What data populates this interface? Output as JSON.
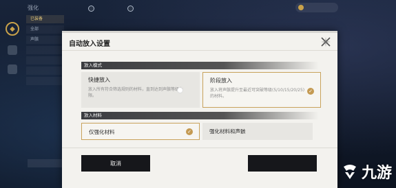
{
  "background": {
    "top_title": "强化",
    "top_right_value": "",
    "left_list": [
      "已装备",
      "全部",
      "声骸",
      "",
      "",
      "",
      ""
    ]
  },
  "modal": {
    "title": "自动放入设置",
    "mode_section": {
      "header": "放入模式",
      "options": [
        {
          "title": "快捷放入",
          "desc": "放入所有符合筛选规则的材料，直到达到声骸等级上限。",
          "selected": false
        },
        {
          "title": "阶段放入",
          "desc": "放入将声骸提升至最近可突破等级(5/10/15/20/25)的材料。",
          "selected": true
        }
      ]
    },
    "material_section": {
      "header": "放入材料",
      "options": [
        {
          "label": "仅强化材料",
          "selected": true
        },
        {
          "label": "强化材料和声骸",
          "selected": false
        }
      ]
    },
    "cancel_label": "取消"
  },
  "watermark": {
    "text": "九游"
  },
  "colors": {
    "accent_gold": "#c49a52",
    "modal_bg": "#f3f2ee",
    "button_dark": "#16171b"
  }
}
